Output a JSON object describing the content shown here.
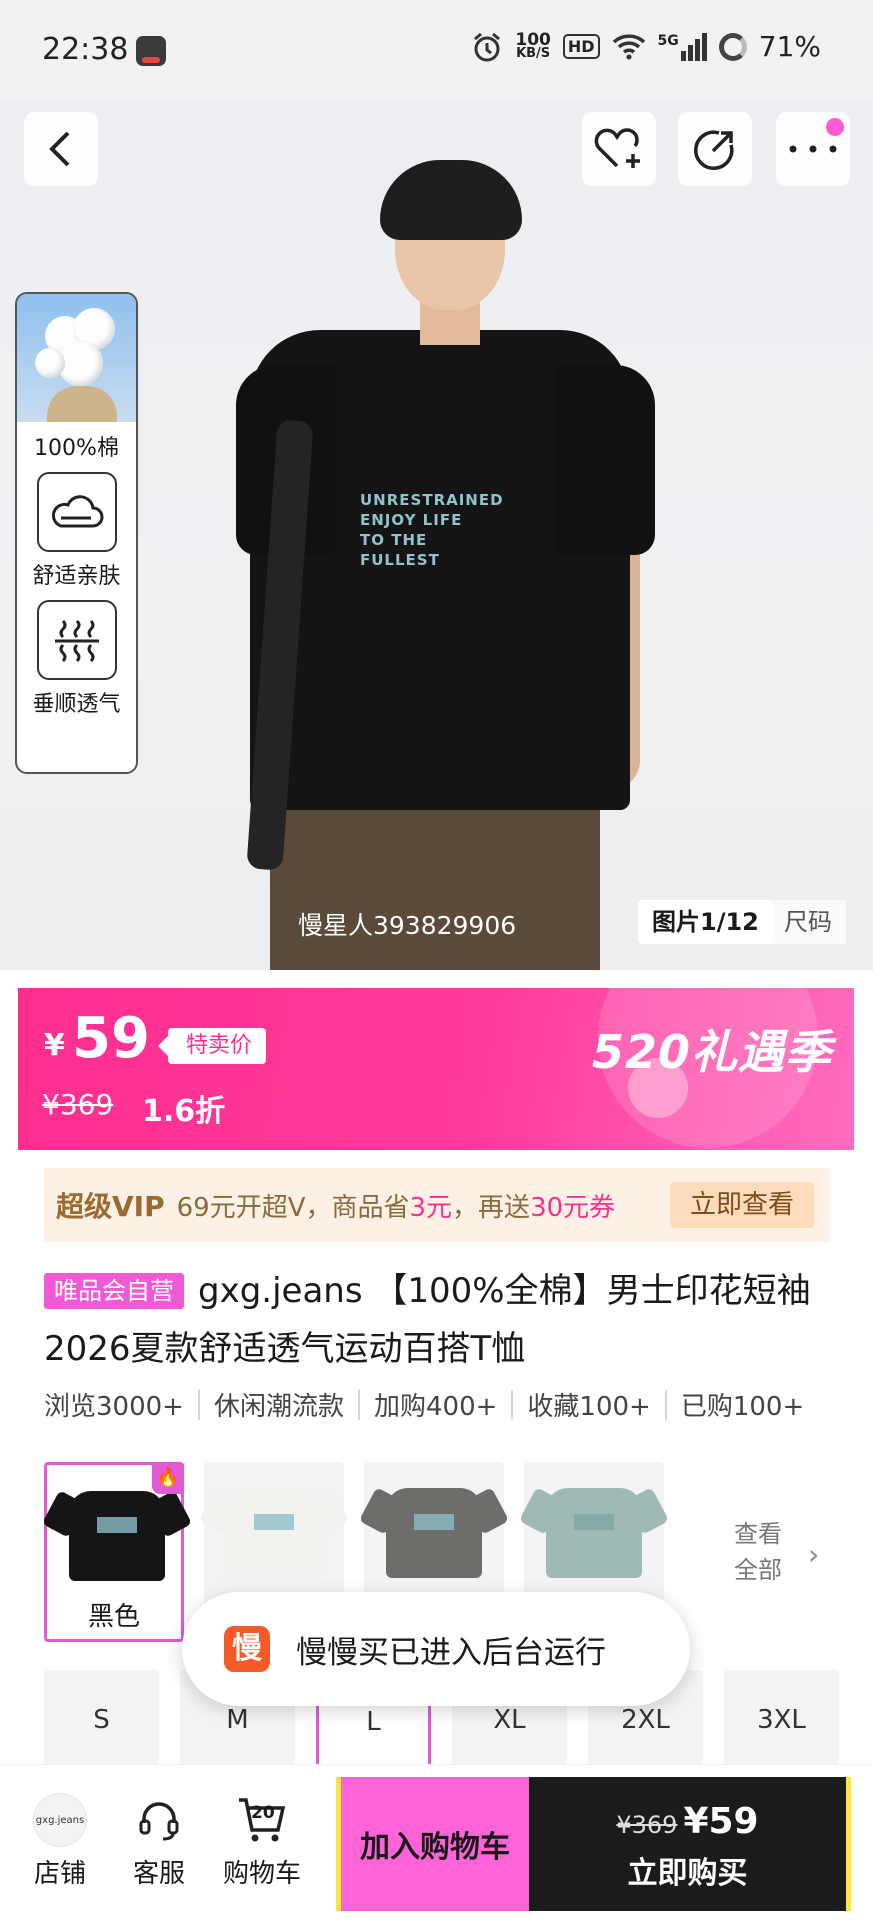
{
  "status_bar": {
    "time": "22:38",
    "net_speed_value": "100",
    "net_speed_unit": "KB/S",
    "hd": "HD",
    "network": "5G",
    "battery": "71%"
  },
  "hero": {
    "counter": "图片1/12",
    "size_tab": "尺码",
    "watermark": "慢星人393829906",
    "shirt_print": [
      "UNRESTRAINED",
      "ENJOY LIFE",
      "TO THE FULLEST"
    ],
    "features": [
      {
        "label": "100%棉",
        "icon": "cotton-image"
      },
      {
        "label": "舒适亲肤",
        "icon": "cloud-icon"
      },
      {
        "label": "垂顺透气",
        "icon": "steam-icon"
      }
    ]
  },
  "price": {
    "currency": "¥",
    "current": "59",
    "tag": "特卖价",
    "original": "¥369",
    "discount": "1.6折",
    "season": "520礼遇季"
  },
  "vip": {
    "badge": "超级VIP",
    "text_a": "69元开超V，商品省",
    "text_b": "3元",
    "text_c": "，再送",
    "text_d": "30元券",
    "button": "立即查看"
  },
  "product": {
    "self_tag": "唯品会自营",
    "title": "gxg.jeans 【100%全棉】男士印花短袖2026夏款舒适透气运动百搭T恤"
  },
  "stats": [
    "浏览3000+",
    "休闲潮流款",
    "加购400+",
    "收藏100+",
    "已购100+"
  ],
  "colors": {
    "selected_name": "黑色",
    "swatch_colors": [
      "#151515",
      "#f3f2ee",
      "#6f6d69",
      "#9fb9b5"
    ],
    "see_all": "查看全部"
  },
  "sizes": [
    "S",
    "M",
    "L",
    "XL",
    "2XL",
    "3XL"
  ],
  "toast": {
    "icon_char": "慢",
    "text": "慢慢买已进入后台运行"
  },
  "bottom_bar": {
    "shop": "店铺",
    "shop_logo": "gxg.jeans",
    "service": "客服",
    "cart": "购物车",
    "cart_count": "20",
    "add_to_cart": "加入购物车",
    "buy_original": "¥369",
    "buy_price": "¥59",
    "buy_now": "立即购买"
  },
  "colors_theme": {
    "accent_pink": "#ff2e8f",
    "select_border": "#e05bd4",
    "cart_btn": "#ff63d8",
    "buy_btn": "#1b1b1b",
    "edge_yellow": "#ffe63b"
  }
}
